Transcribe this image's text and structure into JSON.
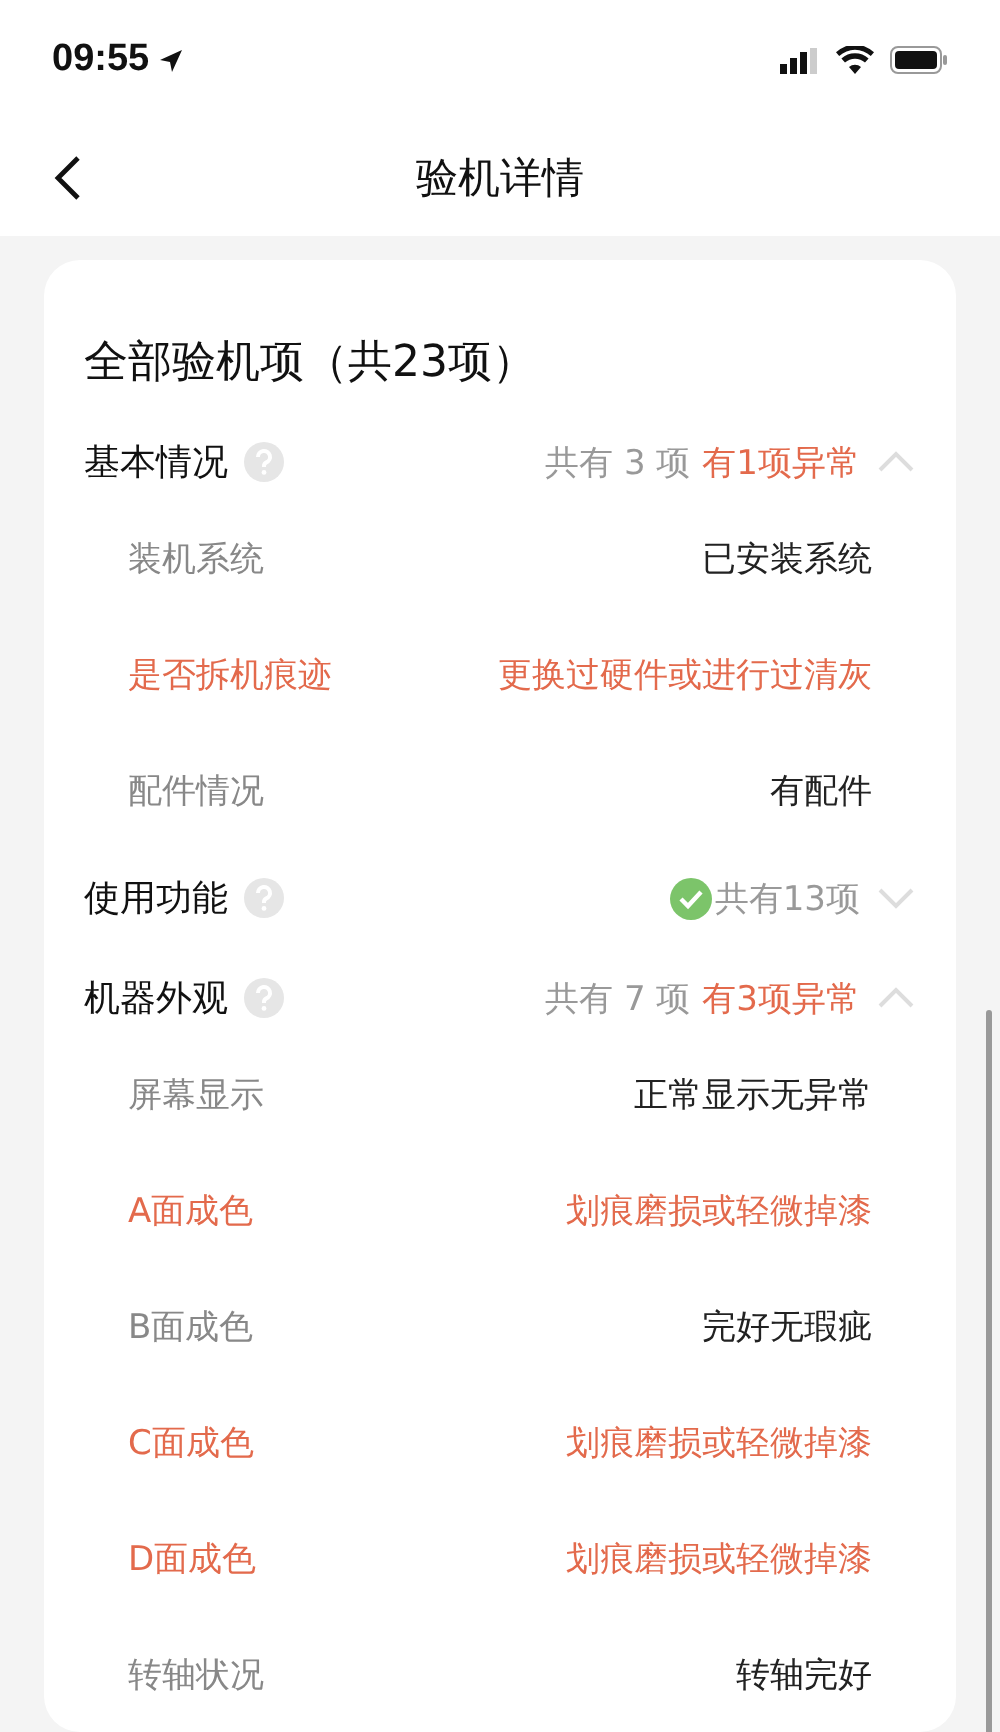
{
  "status_bar": {
    "time": "09:55"
  },
  "nav": {
    "title": "验机详情"
  },
  "card": {
    "title": "全部验机项（共23项）",
    "sections": [
      {
        "title": "基本情况",
        "count_text": "共有 3 项",
        "abnormal_text": "有1项异常",
        "all_passed": false,
        "expanded": true,
        "items": [
          {
            "label": "装机系统",
            "value": "已安装系统",
            "abnormal": false
          },
          {
            "label": "是否拆机痕迹",
            "value": "更换过硬件或进行过清灰",
            "abnormal": true
          },
          {
            "label": "配件情况",
            "value": "有配件",
            "abnormal": false
          }
        ]
      },
      {
        "title": "使用功能",
        "count_text": "共有13项",
        "all_passed": true,
        "expanded": false
      },
      {
        "title": "机器外观",
        "count_text": "共有 7 项",
        "abnormal_text": "有3项异常",
        "all_passed": false,
        "expanded": true,
        "items": [
          {
            "label": "屏幕显示",
            "value": "正常显示无异常",
            "abnormal": false
          },
          {
            "label": "A面成色",
            "value": "划痕磨损或轻微掉漆",
            "abnormal": true
          },
          {
            "label": "B面成色",
            "value": "完好无瑕疵",
            "abnormal": false
          },
          {
            "label": "C面成色",
            "value": "划痕磨损或轻微掉漆",
            "abnormal": true
          },
          {
            "label": "D面成色",
            "value": "划痕磨损或轻微掉漆",
            "abnormal": true
          },
          {
            "label": "转轴状况",
            "value": "转轴完好",
            "abnormal": false
          }
        ]
      }
    ]
  }
}
